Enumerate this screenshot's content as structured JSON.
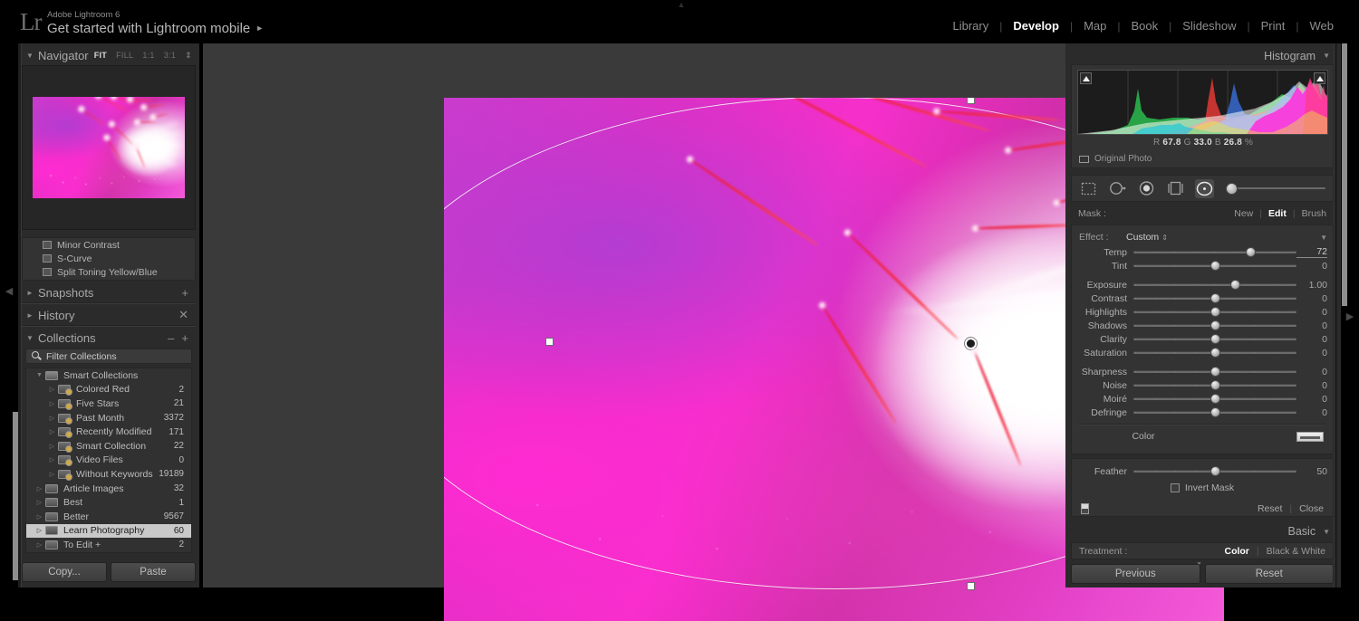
{
  "app": {
    "logo": "Lr",
    "name": "Adobe Lightroom 6",
    "subtitle": "Get started with Lightroom mobile",
    "subtitle_arrow": "►",
    "top_collapse_icon": "▲"
  },
  "modules": [
    {
      "label": "Library",
      "active": false
    },
    {
      "label": "Develop",
      "active": true
    },
    {
      "label": "Map",
      "active": false
    },
    {
      "label": "Book",
      "active": false
    },
    {
      "label": "Slideshow",
      "active": false
    },
    {
      "label": "Print",
      "active": false
    },
    {
      "label": "Web",
      "active": false
    }
  ],
  "module_separator": "|",
  "navigator": {
    "title": "Navigator",
    "triangle": "▼",
    "zoom_levels": [
      {
        "label": "FIT",
        "active": true
      },
      {
        "label": "FILL",
        "active": false
      },
      {
        "label": "1:1",
        "active": false
      },
      {
        "label": "3:1",
        "active": false
      }
    ],
    "spinner": "⇕"
  },
  "presets_tail": [
    {
      "label": "Minor Contrast"
    },
    {
      "label": "S-Curve"
    },
    {
      "label": "Split Toning Yellow/Blue"
    }
  ],
  "snapshots": {
    "title": "Snapshots",
    "triangle": "►",
    "add": "+"
  },
  "history": {
    "title": "History",
    "triangle": "►",
    "clear": "✕"
  },
  "collections": {
    "title": "Collections",
    "triangle": "▼",
    "minus": "–",
    "plus": "+",
    "filter_placeholder": "Filter Collections",
    "filter_value": "Filter Collections",
    "search_icon": "search-icon",
    "items": [
      {
        "label": "Smart Collections",
        "count": "",
        "indent": 1,
        "twisty": "▼",
        "kind": "top",
        "selected": false
      },
      {
        "label": "Colored Red",
        "count": "2",
        "indent": 2,
        "twisty": "▷",
        "kind": "smart",
        "selected": false
      },
      {
        "label": "Five Stars",
        "count": "21",
        "indent": 2,
        "twisty": "▷",
        "kind": "smart",
        "selected": false
      },
      {
        "label": "Past Month",
        "count": "3372",
        "indent": 2,
        "twisty": "▷",
        "kind": "smart",
        "selected": false
      },
      {
        "label": "Recently Modified",
        "count": "171",
        "indent": 2,
        "twisty": "▷",
        "kind": "smart",
        "selected": false
      },
      {
        "label": "Smart Collection",
        "count": "22",
        "indent": 2,
        "twisty": "▷",
        "kind": "smart",
        "selected": false
      },
      {
        "label": "Video Files",
        "count": "0",
        "indent": 2,
        "twisty": "▷",
        "kind": "smart",
        "selected": false
      },
      {
        "label": "Without Keywords",
        "count": "19189",
        "indent": 2,
        "twisty": "▷",
        "kind": "smart",
        "selected": false
      },
      {
        "label": "Article Images",
        "count": "32",
        "indent": 1,
        "twisty": "▷",
        "kind": "box",
        "selected": false
      },
      {
        "label": "Best",
        "count": "1",
        "indent": 1,
        "twisty": "▷",
        "kind": "box",
        "selected": false
      },
      {
        "label": "Better",
        "count": "9567",
        "indent": 1,
        "twisty": "▷",
        "kind": "box",
        "selected": false
      },
      {
        "label": "Learn Photography",
        "count": "60",
        "indent": 1,
        "twisty": "▷",
        "kind": "box",
        "selected": true
      },
      {
        "label": "To Edit  +",
        "count": "2",
        "indent": 1,
        "twisty": "▷",
        "kind": "box",
        "selected": false
      }
    ]
  },
  "left_buttons": {
    "copy": "Copy...",
    "paste": "Paste"
  },
  "left_collapse_icon": "◀",
  "right_collapse_icon": "▶",
  "histogram": {
    "title": "Histogram",
    "triangle": "▼",
    "readout": {
      "r_label": "R",
      "r": "67.8",
      "g_label": "G",
      "g": "33.0",
      "b_label": "B",
      "b": "26.8",
      "unit": "%"
    },
    "original_photo": "Original Photo"
  },
  "tools": [
    {
      "name": "crop-overlay-tool",
      "selected": false
    },
    {
      "name": "spot-removal-tool",
      "selected": false
    },
    {
      "name": "red-eye-tool",
      "selected": false
    },
    {
      "name": "graduated-filter-tool",
      "selected": false
    },
    {
      "name": "radial-filter-tool",
      "selected": true
    }
  ],
  "tool_slider": {
    "value": 8
  },
  "mask": {
    "label": "Mask :",
    "new": "New",
    "edit": "Edit",
    "brush": "Brush",
    "active": "Edit"
  },
  "effect": {
    "label": "Effect :",
    "value": "Custom",
    "spinner": "⇕",
    "triangle": "▼"
  },
  "sliders_group1": [
    {
      "name": "Temp",
      "value": "72",
      "pos": 72,
      "style": "temp",
      "edited": true
    },
    {
      "name": "Tint",
      "value": "0",
      "pos": 50,
      "style": "tint",
      "edited": false
    }
  ],
  "sliders_group2": [
    {
      "name": "Exposure",
      "value": "1.00",
      "pos": 62.5,
      "style": "",
      "edited": false
    },
    {
      "name": "Contrast",
      "value": "0",
      "pos": 50,
      "style": "",
      "edited": false
    },
    {
      "name": "Highlights",
      "value": "0",
      "pos": 50,
      "style": "",
      "edited": false
    },
    {
      "name": "Shadows",
      "value": "0",
      "pos": 50,
      "style": "",
      "edited": false
    },
    {
      "name": "Clarity",
      "value": "0",
      "pos": 50,
      "style": "",
      "edited": false
    },
    {
      "name": "Saturation",
      "value": "0",
      "pos": 50,
      "style": "sat",
      "edited": false
    }
  ],
  "sliders_group3": [
    {
      "name": "Sharpness",
      "value": "0",
      "pos": 50,
      "style": "sharp",
      "edited": false
    },
    {
      "name": "Noise",
      "value": "0",
      "pos": 50,
      "style": "",
      "edited": false
    },
    {
      "name": "Moiré",
      "value": "0",
      "pos": 50,
      "style": "",
      "edited": false
    },
    {
      "name": "Defringe",
      "value": "0",
      "pos": 50,
      "style": "",
      "edited": false
    }
  ],
  "color_row": {
    "label": "Color",
    "swatch_name": "color-swatch"
  },
  "feather": {
    "name": "Feather",
    "value": "50",
    "pos": 50
  },
  "invert_mask": {
    "label": "Invert Mask",
    "checked": false
  },
  "panel_footer": {
    "reset": "Reset",
    "close": "Close",
    "bar": "|"
  },
  "basic": {
    "title": "Basic",
    "triangle": "▼"
  },
  "treatment": {
    "label": "Treatment :",
    "color": "Color",
    "black_white": "Black & White",
    "active": "Color",
    "bar": "|"
  },
  "bottom_buttons": {
    "previous": "Previous",
    "reset": "Reset"
  },
  "radial_filter": {
    "center_pin": "radial-filter-pin",
    "handles": [
      "top",
      "right",
      "bottom",
      "left"
    ]
  },
  "colors": {
    "panel_bg": "#2b2b2b",
    "box_bg": "#333333",
    "canvas_bg": "#3a3a3a",
    "accent_white": "#ffffff",
    "text": "#b3b3b3"
  }
}
